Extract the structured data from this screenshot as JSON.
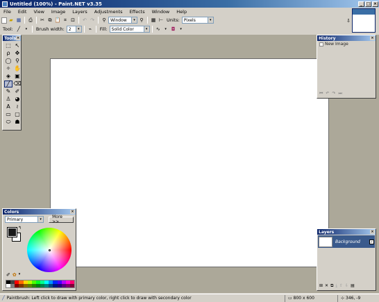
{
  "window": {
    "title": "Untitled (100%) - Paint.NET v3.35",
    "minimize_label": "_",
    "maximize_label": "□",
    "close_label": "×"
  },
  "menu": [
    "File",
    "Edit",
    "View",
    "Image",
    "Layers",
    "Adjustments",
    "Effects",
    "Window",
    "Help"
  ],
  "toolbar": {
    "zoom_value": "Window",
    "units_label": "Units:",
    "units_value": "Pixels",
    "tool_label": "Tool:",
    "brush_width_label": "Brush width:",
    "brush_width_value": "2",
    "fill_label": "Fill:",
    "fill_value": "Solid Color"
  },
  "tools_palette": {
    "title": "Tools",
    "tools": [
      {
        "name": "rectangle-select-icon",
        "glyph": "⬚"
      },
      {
        "name": "move-selection-icon",
        "glyph": "↖"
      },
      {
        "name": "lasso-select-icon",
        "glyph": "ρ"
      },
      {
        "name": "move-selected-icon",
        "glyph": "✥"
      },
      {
        "name": "ellipse-select-icon",
        "glyph": "◯"
      },
      {
        "name": "zoom-icon",
        "glyph": "⚲"
      },
      {
        "name": "magic-wand-icon",
        "glyph": "✧"
      },
      {
        "name": "pan-icon",
        "glyph": "✋"
      },
      {
        "name": "paint-bucket-icon",
        "glyph": "◈"
      },
      {
        "name": "gradient-icon",
        "glyph": "▣"
      },
      {
        "name": "paintbrush-icon",
        "glyph": "╱"
      },
      {
        "name": "eraser-icon",
        "glyph": "⌫"
      },
      {
        "name": "pencil-icon",
        "glyph": "✎"
      },
      {
        "name": "color-picker-icon",
        "glyph": "✐"
      },
      {
        "name": "clone-stamp-icon",
        "glyph": "♙"
      },
      {
        "name": "recolor-icon",
        "glyph": "◕"
      },
      {
        "name": "text-icon",
        "glyph": "A"
      },
      {
        "name": "line-curve-icon",
        "glyph": "≀"
      },
      {
        "name": "rectangle-icon",
        "glyph": "▭"
      },
      {
        "name": "rounded-rectangle-icon",
        "glyph": "▢"
      },
      {
        "name": "ellipse-icon",
        "glyph": "⬭"
      },
      {
        "name": "freeform-shape-icon",
        "glyph": "☗"
      }
    ],
    "active_index": 10
  },
  "history": {
    "title": "History",
    "items": [
      "New Image"
    ]
  },
  "layers": {
    "title": "Layers",
    "items": [
      {
        "name": "Background",
        "visible": true
      }
    ]
  },
  "colors": {
    "title": "Colors",
    "mode": "Primary",
    "more_label": "More >>",
    "primary": "#1a1a1a",
    "secondary": "#ffffff",
    "palette": [
      "#000000",
      "#404040",
      "#ff0000",
      "#ff6a00",
      "#ffd800",
      "#b6ff00",
      "#4cff00",
      "#00ff21",
      "#00ff90",
      "#00ffff",
      "#0094ff",
      "#0026ff",
      "#4800ff",
      "#b200ff",
      "#ff00dc",
      "#ff006e",
      "#ffffff",
      "#808080",
      "#7f0000",
      "#7f3300",
      "#7f6a00",
      "#5b7f00",
      "#267f00",
      "#007f0e",
      "#007f46",
      "#007f7f",
      "#004a7f",
      "#00137f",
      "#21007f",
      "#57007f",
      "#7f006e",
      "#7f0037"
    ]
  },
  "status": {
    "message": "Paintbrush: Left click to draw with primary color, right click to draw with secondary color",
    "image_size": "800 x 600",
    "cursor_pos": "346, -9"
  }
}
